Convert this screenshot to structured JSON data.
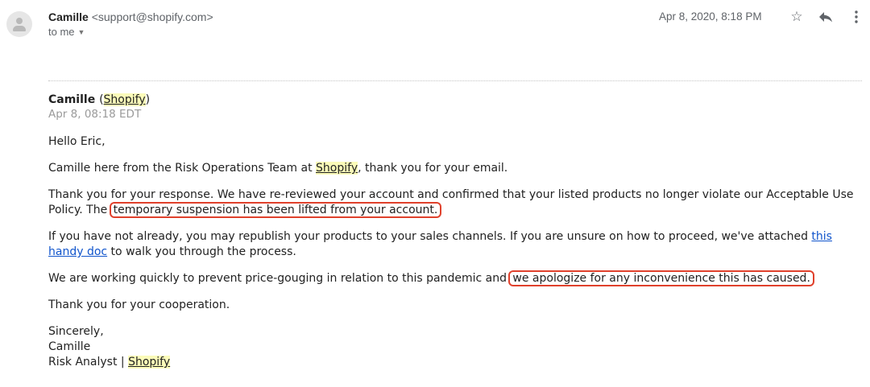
{
  "header": {
    "avatar_icon": "person-icon",
    "sender_name": "Camille",
    "sender_email": "<support@shopify.com>",
    "recipient": "to me",
    "date": "Apr 8, 2020, 8:18 PM",
    "icons": [
      "star-icon",
      "reply-icon",
      "more-vertical-icon"
    ]
  },
  "message": {
    "author_name": "Camille",
    "author_org": "Shopify",
    "date": "Apr 8, 08:18 EDT",
    "greeting": "Hello Eric,",
    "p1": {
      "before": "Camille here from the Risk Operations Team at ",
      "org": "Shopify",
      "after": ", thank you for your email."
    },
    "p2": {
      "before": "Thank you for your response. We have re-reviewed your account and confirmed that your listed products no longer violate our Acceptable Use Policy. The ",
      "highlight": "temporary suspension has been lifted from your account."
    },
    "p3": {
      "before": "If you have not already, you may republish your products to your sales channels. If you are unsure on how to proceed, we've attached ",
      "link": "this handy doc",
      "after": " to walk you through the process."
    },
    "p4": {
      "before": "We are working quickly to prevent price-gouging in relation to this pandemic and ",
      "highlight": "we apologize for any inconvenience this has caused."
    },
    "p5": "Thank you for your cooperation.",
    "closing": "Sincerely,",
    "signature_name": "Camille",
    "signature_title": "Risk Analyst | ",
    "signature_org": "Shopify"
  },
  "colors": {
    "callout_border": "#e0412c",
    "highlight": "#fbfbb9",
    "link": "#1155cc"
  }
}
